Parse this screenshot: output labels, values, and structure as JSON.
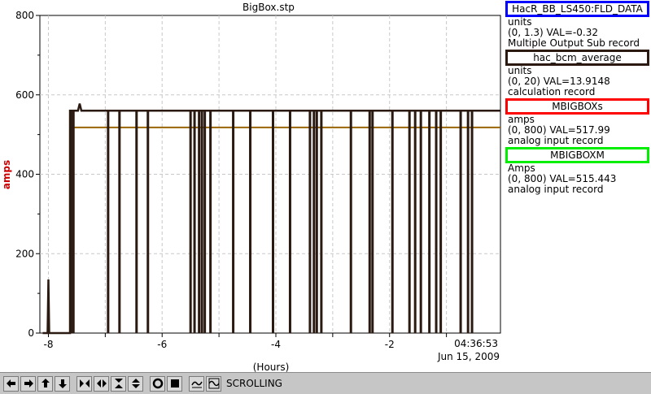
{
  "chart_data": {
    "type": "line",
    "title": "BigBox.stp",
    "xlabel": "(Hours)",
    "ylabel": "amps",
    "xlim": [
      -8.15,
      -0.05
    ],
    "ylim": [
      0,
      800
    ],
    "xticks": [
      "-8",
      "-6",
      "-4",
      "-2"
    ],
    "xtick_values": [
      -8,
      -6,
      -4,
      -2
    ],
    "yticks": [
      "0",
      "200",
      "400",
      "600",
      "800"
    ],
    "ytick_values": [
      0,
      200,
      400,
      600,
      800
    ],
    "grid": true,
    "time_label": "04:36:53",
    "date_label": "Jun 15, 2009",
    "series": [
      {
        "name": "MBIGBOXs",
        "color": "#2a1a12",
        "baseline": 560,
        "start_value": 0,
        "start_x": -8.1,
        "early_spike": {
          "x": -8.0,
          "value": 135
        },
        "ramp_x": -7.62,
        "overshoot": {
          "x": -7.45,
          "value": 578
        },
        "drops": [
          -7.6,
          -7.56,
          -6.95,
          -6.75,
          -6.45,
          -6.25,
          -5.5,
          -5.43,
          -5.35,
          -5.3,
          -5.25,
          -5.15,
          -4.75,
          -4.45,
          -4.05,
          -3.75,
          -3.4,
          -3.33,
          -3.28,
          -3.2,
          -2.68,
          -2.35,
          -2.3,
          -1.95,
          -1.65,
          -1.55,
          -1.45,
          -1.3,
          -1.18,
          -1.1,
          -0.75,
          -0.62,
          -0.55
        ]
      },
      {
        "name": "hac_bcm_average",
        "color": "#9a6400",
        "value": 518,
        "x_start": -7.62,
        "x_end": -0.05
      }
    ]
  },
  "legend": [
    {
      "pv": "HacR_BB_LS450:FLD_DATA",
      "color": "#0000ff",
      "units": "units",
      "range_val": "(0, 1.3) VAL=-0.32",
      "record": "Multiple Output Sub record"
    },
    {
      "pv": "hac_bcm_average",
      "color": "#2a1a12",
      "units": "units",
      "range_val": "(0, 20) VAL=13.9148",
      "record": "calculation record"
    },
    {
      "pv": "MBIGBOXs",
      "color": "#ff0000",
      "units": "amps",
      "range_val": "(0, 800) VAL=517.99",
      "record": "analog input record"
    },
    {
      "pv": "MBIGBOXM",
      "color": "#00ee00",
      "units": "Amps",
      "range_val": "(0, 800) VAL=515.443",
      "record": "analog input record"
    }
  ],
  "toolbar": {
    "status_text": "SCROLLING",
    "buttons": [
      "arrow-left-icon",
      "arrow-right-icon",
      "arrow-up-icon",
      "arrow-down-icon",
      "zoom-in-x-icon",
      "zoom-out-x-icon",
      "zoom-in-y-icon",
      "zoom-out-y-icon",
      "center-icon",
      "reset-icon",
      "auto-scale-icon",
      "style-icon"
    ]
  }
}
